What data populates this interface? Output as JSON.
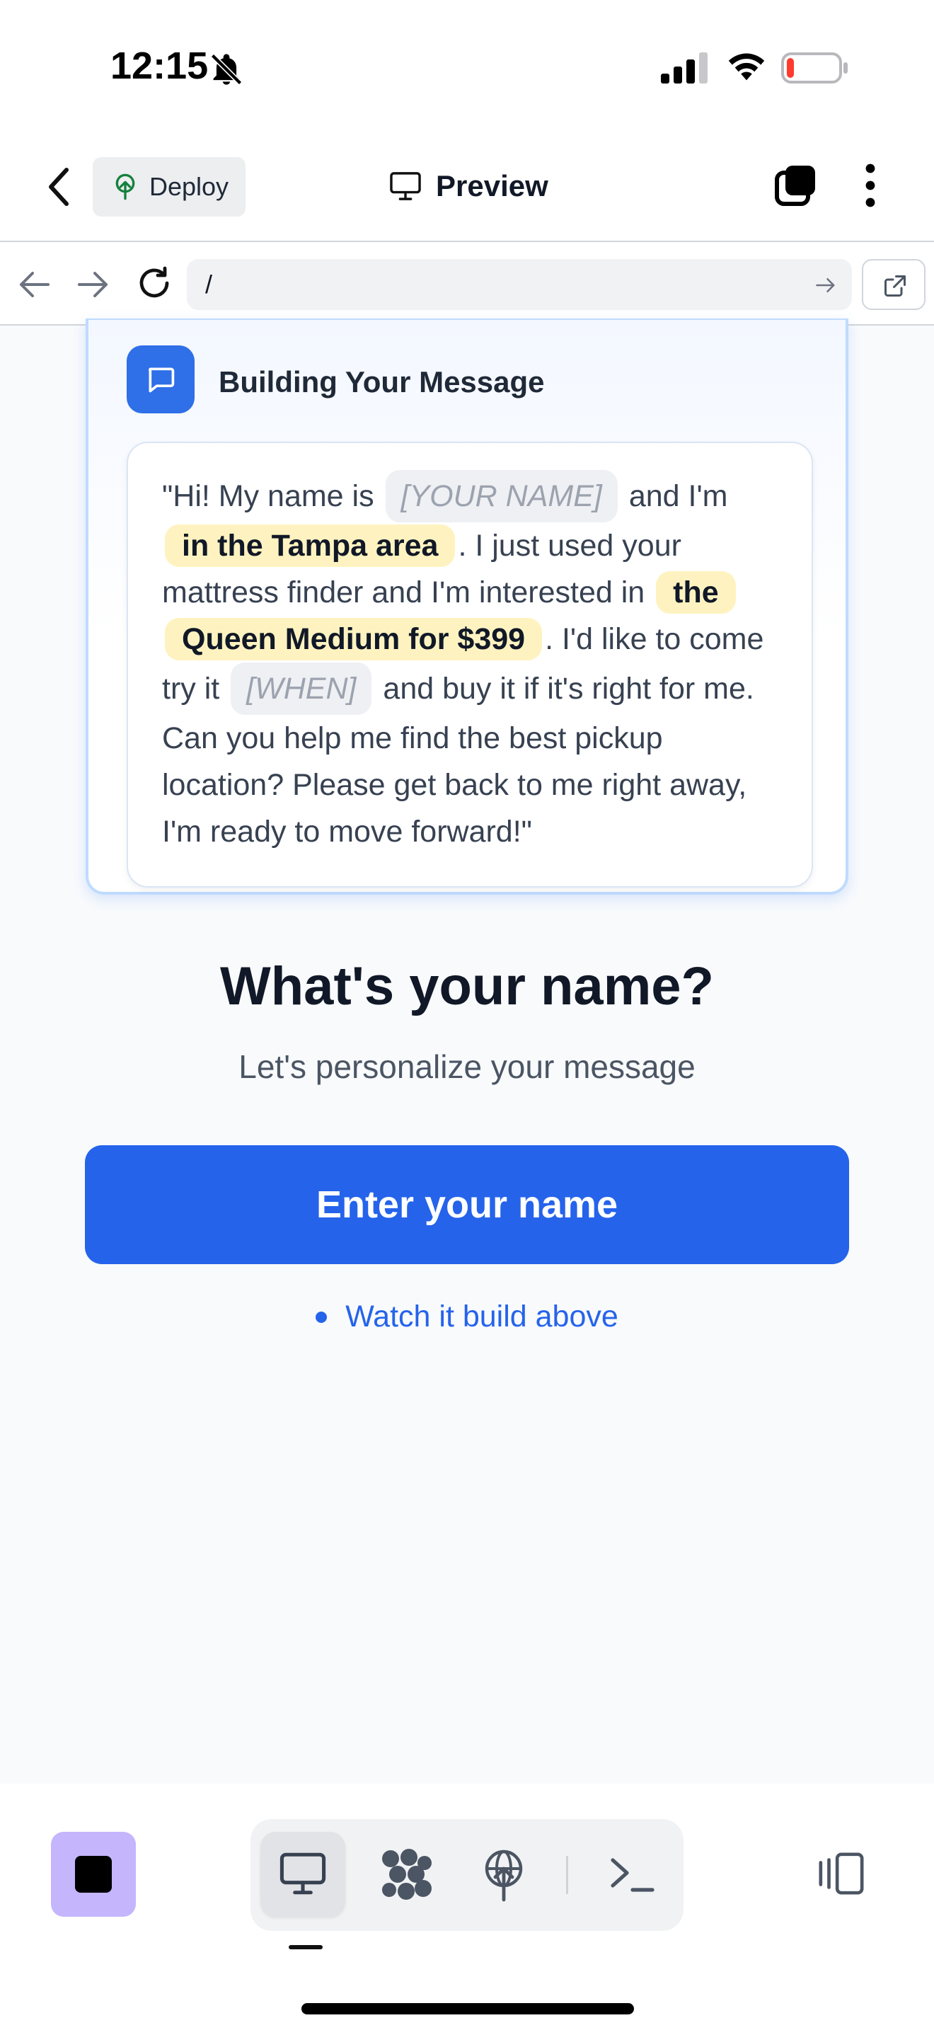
{
  "status_bar": {
    "time": "12:15"
  },
  "header": {
    "deploy_label": "Deploy",
    "title": "Preview"
  },
  "browser": {
    "url": "/"
  },
  "card": {
    "title": "Building Your Message",
    "message": {
      "seg1": "\"Hi! My name is",
      "name_placeholder": "[YOUR NAME]",
      "seg2": "and I'm",
      "area": "in the Tampa area",
      "seg3": ". I just used your mattress finder and I'm interested in",
      "product": "the Queen Medium for $399",
      "seg4": ". I'd like to come try it",
      "when_placeholder": "[WHEN]",
      "seg5": "and buy it if it's right for me. Can you help me find the best pickup location? Please get back to me right away, I'm ready to move forward!\""
    }
  },
  "question": {
    "title": "What's your name?",
    "subtitle": "Let's personalize your message",
    "button_label": "Enter your name",
    "hint": "Watch it build above"
  },
  "colors": {
    "accent": "#2563eb",
    "highlight": "#fef3c0",
    "stop_button": "#c4b5fd"
  },
  "icons": [
    "bell-off-icon",
    "signal-icon",
    "wifi-icon",
    "battery-icon",
    "chevron-left-icon",
    "deploy-tree-icon",
    "monitor-icon",
    "tabs-icon",
    "more-vertical-icon",
    "arrow-left-icon",
    "arrow-right-icon",
    "reload-icon",
    "external-link-icon",
    "chat-icon",
    "stop-icon",
    "database-icon",
    "globe-icon",
    "terminal-icon",
    "panel-icon"
  ]
}
